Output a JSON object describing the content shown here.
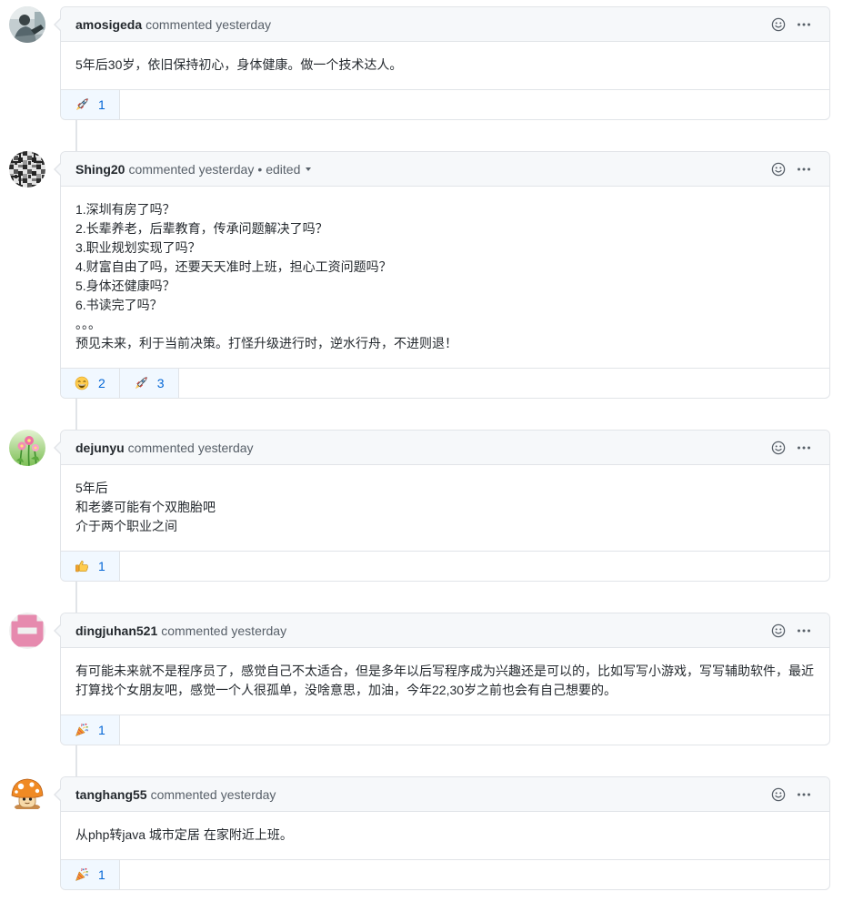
{
  "colors": {
    "text": "#24292e",
    "muted": "#586069",
    "link": "#0366d6",
    "border": "#e1e4e8",
    "header_bg": "#f6f8fa",
    "reacted_bg": "#f1f8ff"
  },
  "comments": [
    {
      "author": "amosigeda",
      "action": "commented",
      "time": "yesterday",
      "body": [
        "5年后30岁，依旧保持初心，身体健康。做一个技术达人。"
      ],
      "reactions": [
        {
          "emoji": "rocket",
          "count": "1"
        }
      ]
    },
    {
      "author": "Shing20",
      "action": "commented",
      "time": "yesterday",
      "edit_separator": "•",
      "edited_label": "edited",
      "body": [
        "1.深圳有房了吗？",
        "2.长辈养老，后辈教育，传承问题解决了吗？",
        "3.职业规划实现了吗？",
        "4.财富自由了吗，还要天天准时上班，担心工资问题吗？",
        "5.身体还健康吗？",
        "6.书读完了吗？",
        "。。。",
        "预见未来，利于当前决策。打怪升级进行时，逆水行舟，不进则退！"
      ],
      "reactions": [
        {
          "emoji": "smile",
          "count": "2"
        },
        {
          "emoji": "rocket",
          "count": "3"
        }
      ]
    },
    {
      "author": "dejunyu",
      "action": "commented",
      "time": "yesterday",
      "body": [
        "5年后",
        "和老婆可能有个双胞胎吧",
        "介于两个职业之间"
      ],
      "reactions": [
        {
          "emoji": "thumbsup",
          "count": "1"
        }
      ]
    },
    {
      "author": "dingjuhan521",
      "action": "commented",
      "time": "yesterday",
      "body": [
        "有可能未来就不是程序员了，感觉自己不太适合，但是多年以后写程序成为兴趣还是可以的，比如写写小游戏，写写辅助软件，最近",
        "打算找个女朋友吧，感觉一个人很孤单，没啥意思，加油，今年22,30岁之前也会有自己想要的。"
      ],
      "reactions": [
        {
          "emoji": "tada",
          "count": "1"
        }
      ]
    },
    {
      "author": "tanghang55",
      "action": "commented",
      "time": "yesterday",
      "body": [
        "从php转java 城市定居 在家附近上班。"
      ],
      "reactions": [
        {
          "emoji": "tada",
          "count": "1"
        }
      ]
    }
  ]
}
